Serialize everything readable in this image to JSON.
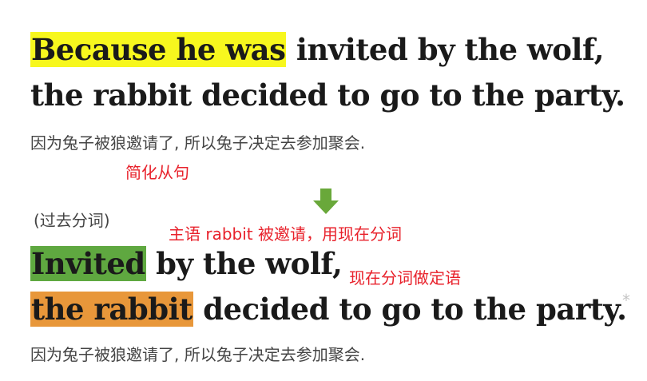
{
  "sentence1": {
    "highlight": "Because he was",
    "line1_rest": " invited by the wolf,",
    "line2": "the rabbit decided to go to the party.",
    "translation": "因为兔子被狼邀请了, 所以兔子决定去参加聚会.",
    "highlight_color": "#f7f71e"
  },
  "annotations": {
    "simplify": "简化从句",
    "past_participle_label": "(过去分词)",
    "subject_note": "主语 rabbit 被邀请，用现在分词",
    "attributive_note": "现在分词做定语",
    "note_color": "#e8212b"
  },
  "arrow": {
    "icon": "down-arrow-icon",
    "color": "#69a83a"
  },
  "sentence2": {
    "word_invited": "Invited",
    "line1_rest": " by the wolf,",
    "word_the_rabbit": "the rabbit",
    "line2_rest": " decided to go to the party.",
    "translation": "因为兔子被狼邀请了, 所以兔子决定去参加聚会.",
    "invited_color": "#5fa840",
    "rabbit_color": "#e8973a"
  },
  "star": "*"
}
